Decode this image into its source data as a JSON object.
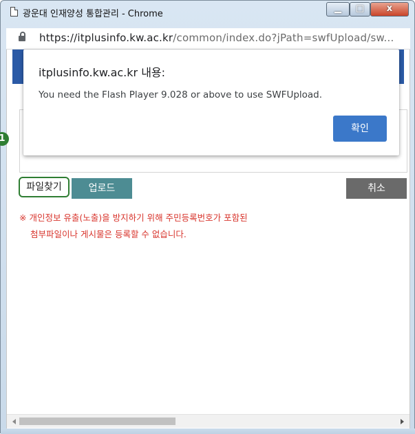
{
  "window": {
    "title": "광운대 인재양성 통합관리 - Chrome",
    "controls": {
      "minimize": "▁",
      "maximize": "□",
      "close": "x"
    }
  },
  "address_bar": {
    "host": "https://itplusinfo.kw.ac.kr",
    "path": "/common/index.do?jPath=swfUpload/sw..."
  },
  "alert": {
    "title": "itplusinfo.kw.ac.kr 내용:",
    "message": "You need the Flash Player 9.028 or above to use SWFUpload.",
    "ok_label": "확인"
  },
  "upload_form": {
    "step_number": "1",
    "find_file_label": "파일찾기",
    "upload_label": "업로드",
    "cancel_label": "취소",
    "notice_line1": "※ 개인정보 유출(노출)을 방지하기 위해 주민등록번호가 포함된",
    "notice_line2": "첨부파일이나 게시물은 등록할 수 없습니다."
  },
  "colors": {
    "accent_green": "#2e7d32",
    "upload_button": "#4d8c93",
    "cancel_button": "#6a6a6a",
    "ok_button": "#3b78c9",
    "notice_text": "#d8342c",
    "header_band": "#2b5aa6"
  },
  "icons": [
    "page-icon",
    "lock-icon",
    "scroll-left-icon",
    "scroll-right-icon"
  ]
}
